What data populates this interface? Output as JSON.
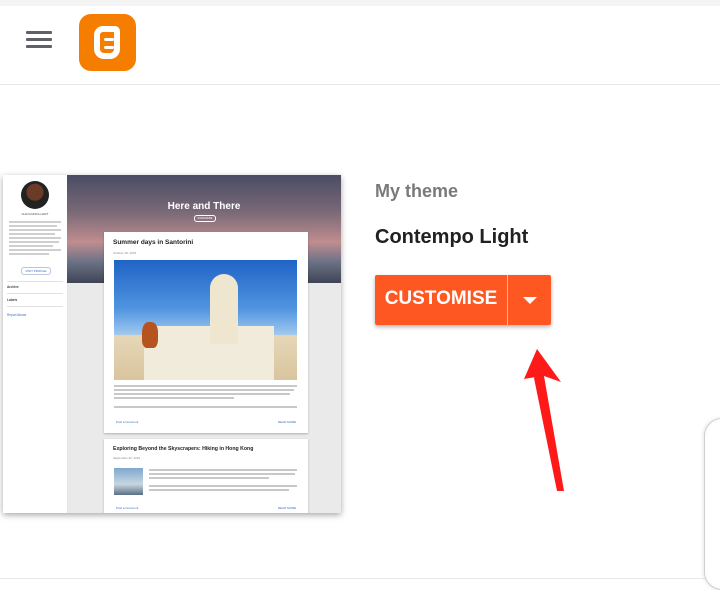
{
  "header": {
    "menu_icon": "hamburger-menu-icon",
    "logo_icon": "blogger-logo-icon",
    "logo_color": "#f57d00"
  },
  "theme_preview": {
    "blog_title": "Here and There",
    "subscribe_label": "SUBSCRIBE",
    "profile_name": "ALEXANDRA HART",
    "visit_profile_label": "VISIT PROFILE",
    "sidebar_links": [
      "Archive",
      "Labels",
      "Report Abuse"
    ],
    "posts": [
      {
        "title": "Summer days in Santorini",
        "date": "October 18, 2015",
        "read_more": "READ MORE",
        "comments": "Post a Comment"
      },
      {
        "title": "Exploring Beyond the Skyscrapers: Hiking in Hong Kong",
        "date": "September 22, 2015",
        "read_more": "READ MORE",
        "comments": "Post a Comment"
      }
    ]
  },
  "theme": {
    "section_label": "My theme",
    "name": "Contempo Light"
  },
  "actions": {
    "customise_label": "CUSTOMISE",
    "dropdown_icon": "caret-down-icon",
    "accent_color": "#ff5722"
  },
  "annotation": {
    "arrow_color": "#ff1a1a"
  }
}
